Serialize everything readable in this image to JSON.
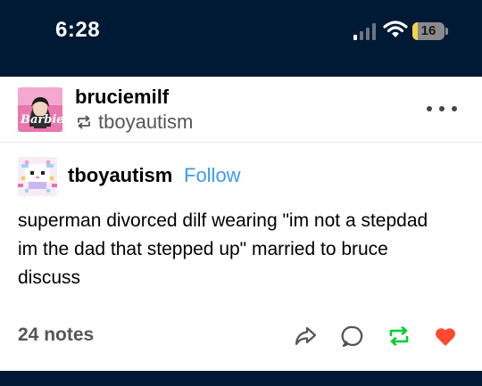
{
  "status_bar": {
    "time": "6:28",
    "battery_level": "16",
    "battery_fraction": 0.16,
    "signal_icon": "cellular-signal-icon",
    "wifi_icon": "wifi-icon",
    "battery_color": "#f5d14e"
  },
  "post": {
    "reblogger": {
      "username": "bruciemilf",
      "avatar_icon": "barbie-avatar",
      "avatar_logo_text": "Barbie"
    },
    "reblogged_from": {
      "username": "tboyautism",
      "icon": "reblog-icon"
    },
    "more_icon": "more-options-icon",
    "source": {
      "username": "tboyautism",
      "follow_label": "Follow",
      "avatar_icon": "pixel-art-avatar"
    },
    "body_lines": [
      "superman divorced dilf wearing \"im not a stepdad",
      "im the dad that stepped up\" married to bruce",
      "discuss"
    ],
    "notes_label": "24 notes",
    "actions": [
      {
        "name": "share-icon",
        "color": "#555555"
      },
      {
        "name": "reply-icon",
        "color": "#555555"
      },
      {
        "name": "reblog-icon",
        "color": "#00cf35"
      },
      {
        "name": "like-heart-icon",
        "color": "#ff4930"
      }
    ]
  },
  "colors": {
    "background": "#001935",
    "link": "#3b9af0"
  }
}
